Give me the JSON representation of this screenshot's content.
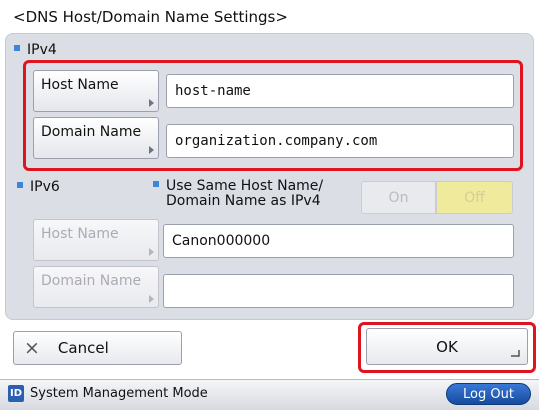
{
  "title": "<DNS Host/Domain Name Settings>",
  "ipv4": {
    "label": "IPv4",
    "host_name_label": "Host Name",
    "host_name_value": "host-name",
    "domain_name_label": "Domain Name",
    "domain_name_value": "organization.company.com"
  },
  "ipv6": {
    "label": "IPv6",
    "same_name_label_line1": "Use Same Host Name/",
    "same_name_label_line2": "Domain Name as IPv4",
    "on_label": "On",
    "off_label": "Off",
    "host_name_label": "Host Name",
    "host_name_value": "Canon000000",
    "domain_name_label": "Domain Name",
    "domain_name_value": ""
  },
  "buttons": {
    "cancel": "Cancel",
    "cancel_icon": "×",
    "ok": "OK"
  },
  "status": {
    "mode_icon_text": "ID",
    "mode_text": "System Management Mode",
    "logout": "Log Out"
  },
  "colors": {
    "highlight": "#e0141e",
    "off_active": "#f0ea9c",
    "logout_blue": "#1e5bb8"
  }
}
